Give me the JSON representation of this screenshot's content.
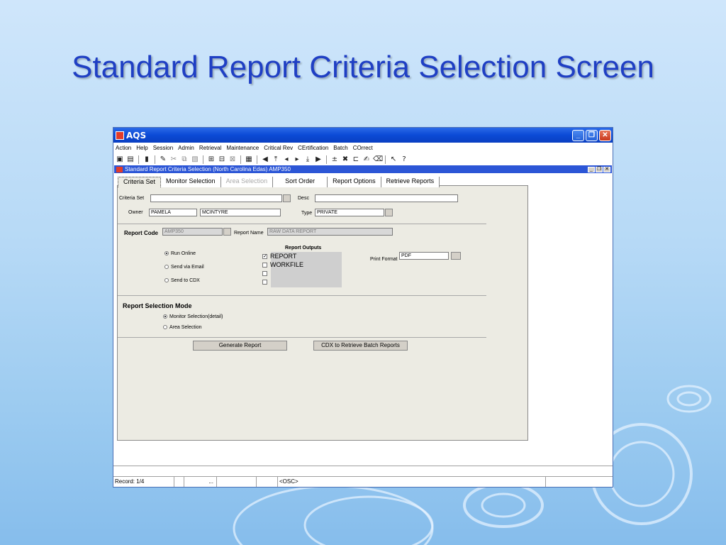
{
  "slide": {
    "title": "Standard Report Criteria Selection Screen"
  },
  "window": {
    "app_title": "AQS",
    "controls": {
      "minimize": "_",
      "maximize": "❐",
      "close": "✕"
    }
  },
  "menu": [
    "Action",
    "Help",
    "Session",
    "Admin",
    "Retrieval",
    "Maintenance",
    "Critical Rev",
    "CErtification",
    "Batch",
    "COrrect"
  ],
  "toolbar": {
    "icons": [
      "save-icon",
      "print-icon",
      "exit-icon",
      "edit-icon",
      "cut-icon",
      "copy-icon",
      "paste-icon",
      "query-icon",
      "execute-query-icon",
      "cancel-query-icon",
      "list-icon",
      "first-record-icon",
      "previous-block-icon",
      "previous-record-icon",
      "next-record-icon",
      "next-block-icon",
      "last-record-icon",
      "insert-record-icon",
      "delete-record-icon",
      "duplicate-record-icon",
      "edit-field-icon",
      "clear-icon",
      "help-pointer-icon",
      "help-icon"
    ]
  },
  "subwindow": {
    "title": "Standard Report Criteria Selection (North Carolina  Edas) AMP350",
    "controls": {
      "minimize": "_",
      "restore": "❐",
      "close": "✕"
    }
  },
  "tabs": [
    {
      "label": "Criteria Set",
      "active": true
    },
    {
      "label": "Monitor Selection"
    },
    {
      "label": "Area Selection",
      "disabled": true
    },
    {
      "label": "Sort Order"
    },
    {
      "label": "Report Options"
    },
    {
      "label": "Retrieve Reports"
    }
  ],
  "criteria": {
    "criteria_set_label": "Criteria Set",
    "criteria_set_value": "",
    "desc_label": "Desc",
    "desc_value": "",
    "owner_label": "Owner",
    "owner_first": "PAMELA",
    "owner_last": "MCINTYRE",
    "type_label": "Type",
    "type_value": "PRIVATE"
  },
  "report": {
    "code_label": "Report Code",
    "code_value": "AMP350",
    "name_label": "Report Name",
    "name_value": "RAW DATA REPORT",
    "run_online": "Run Online",
    "send_email": "Send via Email",
    "send_cdx": "Send to CDX",
    "outputs_label": "Report Outputs",
    "output_report": "REPORT",
    "output_workfile": "WORKFILE",
    "print_format_label": "Print Format",
    "print_format_value": "PDF"
  },
  "selection_mode": {
    "label": "Report Selection Mode",
    "monitor": "Monitor Selection(detail)",
    "area": "Area Selection"
  },
  "buttons": {
    "generate": "Generate Report",
    "cdx_retrieve": "CDX to Retrieve Batch Reports"
  },
  "statusbar": {
    "record": "Record: 1/4",
    "ellipsis": "...",
    "osc": "<OSC>"
  }
}
